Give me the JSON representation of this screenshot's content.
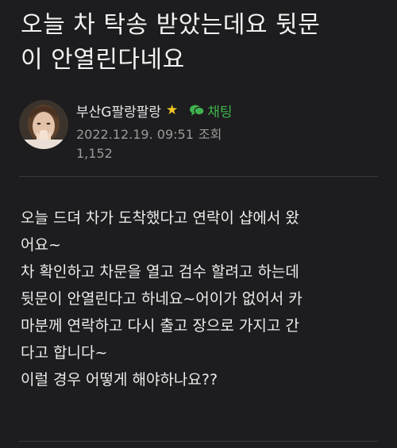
{
  "post": {
    "title_line1": "오늘 차 탁송 받았는데요 뒷문",
    "title_line2": "이 안열린다네요",
    "author": "부산G팔랑팔랑",
    "author_badge_icon": "star-icon",
    "chat_label": "채팅",
    "chat_icon": "chat-bubble-icon",
    "date": "2022.12.19. 09:51",
    "views_label": "조회",
    "views_count": "1,152",
    "body": [
      "오늘 드뎌 차가 도착했다고 연락이 샵에서 왔",
      "어요~",
      "차 확인하고 차문을 열고 검수 할려고 하는데",
      "뒷문이 안열린다고 하네요~어이가 없어서 카",
      "마분께 연락하고 다시 출고 장으로 가지고 간",
      "다고 합니다~",
      "이럴 경우 어떻게 해야하나요??"
    ]
  },
  "colors": {
    "background": "#1d1d1f",
    "text": "#ececec",
    "meta": "#9a9a9a",
    "chat_accent": "#3fb24c",
    "star": "#f3c623"
  }
}
